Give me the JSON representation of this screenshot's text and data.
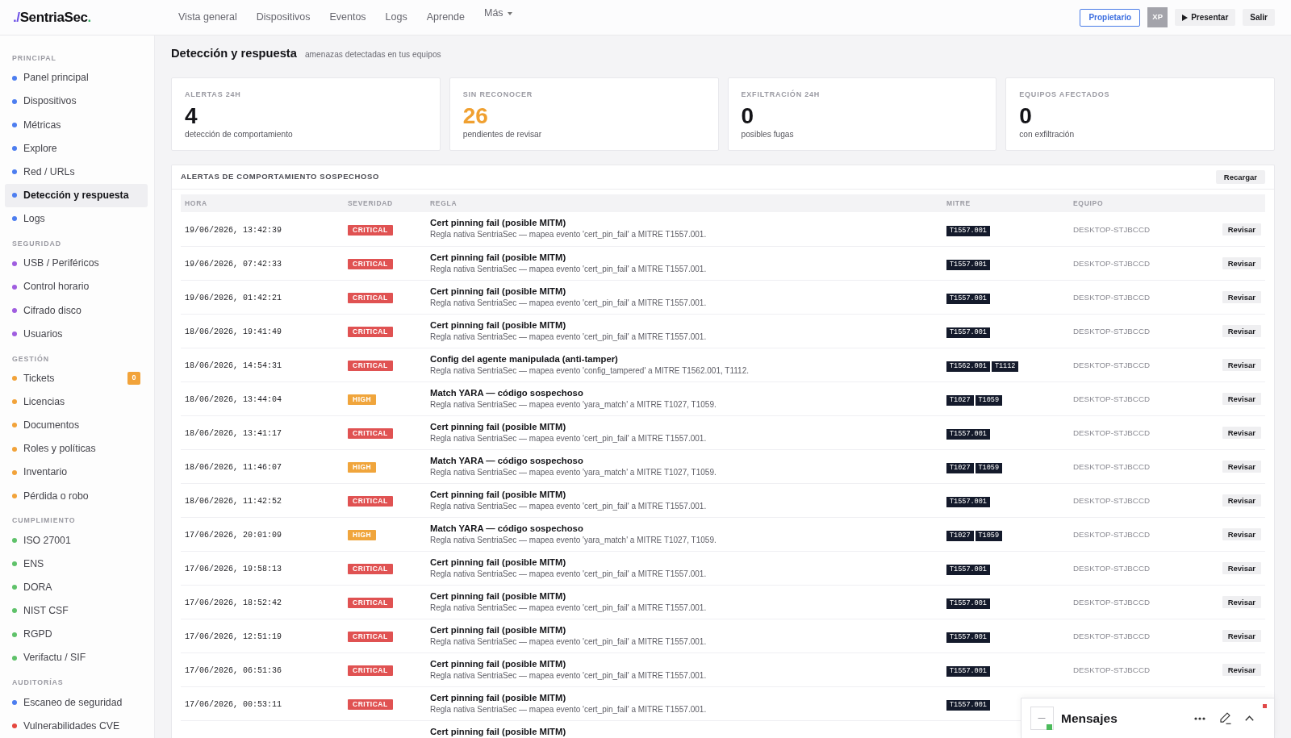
{
  "app": {
    "logo": [
      {
        "text": "./",
        "color": "#6b4ee6"
      },
      {
        "text": "SentriaSec",
        "color": "#111114"
      },
      {
        "text": ".",
        "color": "#3db36a"
      }
    ],
    "nav": [
      {
        "label": "Vista general",
        "dropdown": false
      },
      {
        "label": "Dispositivos",
        "dropdown": false
      },
      {
        "label": "Eventos",
        "dropdown": false
      },
      {
        "label": "Logs",
        "dropdown": false
      },
      {
        "label": "Aprende",
        "dropdown": false
      },
      {
        "label": "Más",
        "dropdown": true
      }
    ],
    "role_button": "Propietario",
    "avatar": "XP",
    "present_button": "Presentar",
    "logout_button": "Salir"
  },
  "sidebar": {
    "sections": [
      {
        "heading": "PRINCIPAL",
        "items": [
          {
            "label": "Panel principal",
            "color": "#4d7ef0",
            "selected": false
          },
          {
            "label": "Dispositivos",
            "color": "#4d7ef0",
            "selected": false
          },
          {
            "label": "Métricas",
            "color": "#4d7ef0",
            "selected": false
          },
          {
            "label": "Explore",
            "color": "#4d7ef0",
            "selected": false
          },
          {
            "label": "Red / URLs",
            "color": "#4d7ef0",
            "selected": false
          },
          {
            "label": "Detección y respuesta",
            "color": "#4d7ef0",
            "selected": true
          },
          {
            "label": "Logs",
            "color": "#4d7ef0",
            "selected": false
          }
        ]
      },
      {
        "heading": "SEGURIDAD",
        "items": [
          {
            "label": "USB / Periféricos",
            "color": "#a05ee0",
            "selected": false
          },
          {
            "label": "Control horario",
            "color": "#a05ee0",
            "selected": false
          },
          {
            "label": "Cifrado disco",
            "color": "#a05ee0",
            "selected": false
          },
          {
            "label": "Usuarios",
            "color": "#a05ee0",
            "selected": false
          }
        ]
      },
      {
        "heading": "GESTIÓN",
        "items": [
          {
            "label": "Tickets",
            "color": "#f2a33a",
            "selected": false,
            "badge": "0"
          },
          {
            "label": "Licencias",
            "color": "#f2a33a",
            "selected": false
          },
          {
            "label": "Documentos",
            "color": "#f2a33a",
            "selected": false
          },
          {
            "label": "Roles y políticas",
            "color": "#f2a33a",
            "selected": false
          },
          {
            "label": "Inventario",
            "color": "#f2a33a",
            "selected": false
          },
          {
            "label": "Pérdida o robo",
            "color": "#f2a33a",
            "selected": false
          }
        ]
      },
      {
        "heading": "CUMPLIMIENTO",
        "items": [
          {
            "label": "ISO 27001",
            "color": "#5fc26a",
            "selected": false
          },
          {
            "label": "ENS",
            "color": "#5fc26a",
            "selected": false
          },
          {
            "label": "DORA",
            "color": "#5fc26a",
            "selected": false
          },
          {
            "label": "NIST CSF",
            "color": "#5fc26a",
            "selected": false
          },
          {
            "label": "RGPD",
            "color": "#5fc26a",
            "selected": false
          },
          {
            "label": "Verifactu / SIF",
            "color": "#5fc26a",
            "selected": false
          }
        ]
      },
      {
        "heading": "AUDITORÍAS",
        "items": [
          {
            "label": "Escaneo de seguridad",
            "color": "#4d7ef0",
            "selected": false
          },
          {
            "label": "Vulnerabilidades CVE",
            "color": "#e5483f",
            "selected": false
          }
        ]
      }
    ]
  },
  "page": {
    "title": "Detección y respuesta",
    "subtitle": "amenazas detectadas en tus equipos"
  },
  "stats": [
    {
      "label": "ALERTAS 24H",
      "value": "4",
      "caption": "detección de comportamiento",
      "highlight": false
    },
    {
      "label": "SIN RECONOCER",
      "value": "26",
      "caption": "pendientes de revisar",
      "highlight": true
    },
    {
      "label": "EXFILTRACIÓN 24H",
      "value": "0",
      "caption": "posibles fugas",
      "highlight": false
    },
    {
      "label": "EQUIPOS AFECTADOS",
      "value": "0",
      "caption": "con exfiltración",
      "highlight": false
    }
  ],
  "alerts": {
    "title": "ALERTAS DE COMPORTAMIENTO SOSPECHOSO",
    "reload_button": "Recargar",
    "columns": [
      "HORA",
      "SEVERIDAD",
      "REGLA",
      "MITRE",
      "EQUIPO"
    ],
    "rows": [
      {
        "time": "19/06/2026, 13:42:39",
        "severity": {
          "text": "CRITICAL",
          "color": "#e05252"
        },
        "rule": "Cert pinning fail (posible MITM)",
        "description": "Regla nativa SentriaSec — mapea evento 'cert_pin_fail' a MITRE T1557.001.",
        "mitre": [
          "T1557.001"
        ],
        "device": "DESKTOP-STJBCCD",
        "action": "Revisar"
      },
      {
        "time": "19/06/2026, 07:42:33",
        "severity": {
          "text": "CRITICAL",
          "color": "#e05252"
        },
        "rule": "Cert pinning fail (posible MITM)",
        "description": "Regla nativa SentriaSec — mapea evento 'cert_pin_fail' a MITRE T1557.001.",
        "mitre": [
          "T1557.001"
        ],
        "device": "DESKTOP-STJBCCD",
        "action": "Revisar"
      },
      {
        "time": "19/06/2026, 01:42:21",
        "severity": {
          "text": "CRITICAL",
          "color": "#e05252"
        },
        "rule": "Cert pinning fail (posible MITM)",
        "description": "Regla nativa SentriaSec — mapea evento 'cert_pin_fail' a MITRE T1557.001.",
        "mitre": [
          "T1557.001"
        ],
        "device": "DESKTOP-STJBCCD",
        "action": "Revisar"
      },
      {
        "time": "18/06/2026, 19:41:49",
        "severity": {
          "text": "CRITICAL",
          "color": "#e05252"
        },
        "rule": "Cert pinning fail (posible MITM)",
        "description": "Regla nativa SentriaSec — mapea evento 'cert_pin_fail' a MITRE T1557.001.",
        "mitre": [
          "T1557.001"
        ],
        "device": "DESKTOP-STJBCCD",
        "action": "Revisar"
      },
      {
        "time": "18/06/2026, 14:54:31",
        "severity": {
          "text": "CRITICAL",
          "color": "#e05252"
        },
        "rule": "Config del agente manipulada (anti-tamper)",
        "description": "Regla nativa SentriaSec — mapea evento 'config_tampered' a MITRE T1562.001, T1112.",
        "mitre": [
          "T1562.001",
          "T1112"
        ],
        "device": "DESKTOP-STJBCCD",
        "action": "Revisar"
      },
      {
        "time": "18/06/2026, 13:44:04",
        "severity": {
          "text": "HIGH",
          "color": "#f0a53c"
        },
        "rule": "Match YARA — código sospechoso",
        "description": "Regla nativa SentriaSec — mapea evento 'yara_match' a MITRE T1027, T1059.",
        "mitre": [
          "T1027",
          "T1059"
        ],
        "device": "DESKTOP-STJBCCD",
        "action": "Revisar"
      },
      {
        "time": "18/06/2026, 13:41:17",
        "severity": {
          "text": "CRITICAL",
          "color": "#e05252"
        },
        "rule": "Cert pinning fail (posible MITM)",
        "description": "Regla nativa SentriaSec — mapea evento 'cert_pin_fail' a MITRE T1557.001.",
        "mitre": [
          "T1557.001"
        ],
        "device": "DESKTOP-STJBCCD",
        "action": "Revisar"
      },
      {
        "time": "18/06/2026, 11:46:07",
        "severity": {
          "text": "HIGH",
          "color": "#f0a53c"
        },
        "rule": "Match YARA — código sospechoso",
        "description": "Regla nativa SentriaSec — mapea evento 'yara_match' a MITRE T1027, T1059.",
        "mitre": [
          "T1027",
          "T1059"
        ],
        "device": "DESKTOP-STJBCCD",
        "action": "Revisar"
      },
      {
        "time": "18/06/2026, 11:42:52",
        "severity": {
          "text": "CRITICAL",
          "color": "#e05252"
        },
        "rule": "Cert pinning fail (posible MITM)",
        "description": "Regla nativa SentriaSec — mapea evento 'cert_pin_fail' a MITRE T1557.001.",
        "mitre": [
          "T1557.001"
        ],
        "device": "DESKTOP-STJBCCD",
        "action": "Revisar"
      },
      {
        "time": "17/06/2026, 20:01:09",
        "severity": {
          "text": "HIGH",
          "color": "#f0a53c"
        },
        "rule": "Match YARA — código sospechoso",
        "description": "Regla nativa SentriaSec — mapea evento 'yara_match' a MITRE T1027, T1059.",
        "mitre": [
          "T1027",
          "T1059"
        ],
        "device": "DESKTOP-STJBCCD",
        "action": "Revisar"
      },
      {
        "time": "17/06/2026, 19:58:13",
        "severity": {
          "text": "CRITICAL",
          "color": "#e05252"
        },
        "rule": "Cert pinning fail (posible MITM)",
        "description": "Regla nativa SentriaSec — mapea evento 'cert_pin_fail' a MITRE T1557.001.",
        "mitre": [
          "T1557.001"
        ],
        "device": "DESKTOP-STJBCCD",
        "action": "Revisar"
      },
      {
        "time": "17/06/2026, 18:52:42",
        "severity": {
          "text": "CRITICAL",
          "color": "#e05252"
        },
        "rule": "Cert pinning fail (posible MITM)",
        "description": "Regla nativa SentriaSec — mapea evento 'cert_pin_fail' a MITRE T1557.001.",
        "mitre": [
          "T1557.001"
        ],
        "device": "DESKTOP-STJBCCD",
        "action": "Revisar"
      },
      {
        "time": "17/06/2026, 12:51:19",
        "severity": {
          "text": "CRITICAL",
          "color": "#e05252"
        },
        "rule": "Cert pinning fail (posible MITM)",
        "description": "Regla nativa SentriaSec — mapea evento 'cert_pin_fail' a MITRE T1557.001.",
        "mitre": [
          "T1557.001"
        ],
        "device": "DESKTOP-STJBCCD",
        "action": "Revisar"
      },
      {
        "time": "17/06/2026, 06:51:36",
        "severity": {
          "text": "CRITICAL",
          "color": "#e05252"
        },
        "rule": "Cert pinning fail (posible MITM)",
        "description": "Regla nativa SentriaSec — mapea evento 'cert_pin_fail' a MITRE T1557.001.",
        "mitre": [
          "T1557.001"
        ],
        "device": "DESKTOP-STJBCCD",
        "action": "Revisar"
      },
      {
        "time": "17/06/2026, 00:53:11",
        "severity": {
          "text": "CRITICAL",
          "color": "#e05252"
        },
        "rule": "Cert pinning fail (posible MITM)",
        "description": "Regla nativa SentriaSec — mapea evento 'cert_pin_fail' a MITRE T1557.001.",
        "mitre": [
          "T1557.001"
        ]
      },
      {
        "rule": "Cert pinning fail (posible MITM)"
      }
    ]
  },
  "messages": {
    "title": "Mensajes",
    "online": true,
    "unread": true
  }
}
